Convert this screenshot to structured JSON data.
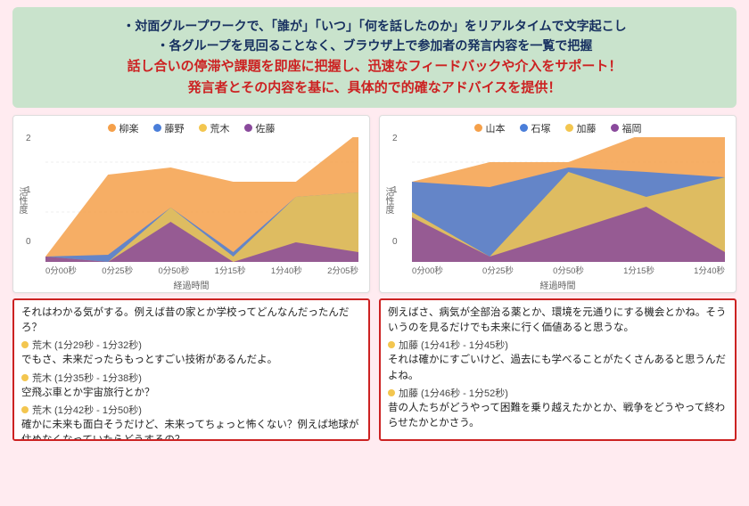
{
  "header": {
    "line1": "・対面グループワークで、「誰が」「いつ」「何を話したのか」をリアルタイムで文字起こし",
    "line2": "・各グループを見回ることなく、ブラウザ上で参加者の発言内容を一覧で把握",
    "line3": "話し合いの停滞や課題を即座に把握し、迅速なフィードバックや介入をサポート！",
    "line4": "発言者とその内容を基に、具体的で的確なアドバイスを提供！"
  },
  "chart_data": [
    {
      "type": "area",
      "title": "",
      "xlabel": "経過時間",
      "ylabel": "活性度",
      "ylim": [
        0,
        2.5
      ],
      "y_ticks": [
        0,
        1,
        2
      ],
      "categories": [
        "0分00秒",
        "0分25秒",
        "0分50秒",
        "1分15秒",
        "1分40秒",
        "2分05秒"
      ],
      "series": [
        {
          "name": "柳楽",
          "color": "#f5a04a",
          "values": [
            0.0,
            1.6,
            0.8,
            1.4,
            0.3,
            1.2
          ]
        },
        {
          "name": "藤野",
          "color": "#4a7ed9",
          "values": [
            0.0,
            0.1,
            0.0,
            0.1,
            0.0,
            0.1
          ]
        },
        {
          "name": "荒木",
          "color": "#f3c64f",
          "values": [
            0.0,
            0.0,
            0.3,
            0.1,
            0.9,
            1.2
          ]
        },
        {
          "name": "佐藤",
          "color": "#8a4a9c",
          "values": [
            0.1,
            0.0,
            0.8,
            0.0,
            0.4,
            0.2
          ]
        }
      ]
    },
    {
      "type": "area",
      "title": "",
      "xlabel": "経過時間",
      "ylabel": "活性度",
      "ylim": [
        0,
        2.5
      ],
      "y_ticks": [
        0,
        1,
        2
      ],
      "categories": [
        "0分00秒",
        "0分25秒",
        "0分50秒",
        "1分15秒",
        "1分40秒"
      ],
      "series": [
        {
          "name": "山本",
          "color": "#f5a04a",
          "values": [
            0.0,
            0.5,
            0.1,
            0.8,
            1.2
          ]
        },
        {
          "name": "石塚",
          "color": "#4a7ed9",
          "values": [
            0.6,
            1.4,
            0.1,
            0.5,
            0.0
          ]
        },
        {
          "name": "加藤",
          "color": "#f3c64f",
          "values": [
            0.1,
            0.0,
            1.2,
            0.2,
            1.5
          ]
        },
        {
          "name": "福岡",
          "color": "#8a4a9c",
          "values": [
            0.9,
            0.1,
            0.6,
            1.1,
            0.2
          ]
        }
      ]
    }
  ],
  "transcripts": {
    "left": [
      {
        "type": "text",
        "text": "それはわかる気がする。例えば昔の家とか学校ってどんなんだったんだろ？"
      },
      {
        "type": "speaker",
        "color": "#f3c64f",
        "text": "荒木 (1分29秒 - 1分32秒)"
      },
      {
        "type": "text",
        "text": "でもさ、未来だったらもっとすごい技術があるんだよ。"
      },
      {
        "type": "speaker",
        "color": "#f3c64f",
        "text": "荒木 (1分35秒 - 1分38秒)"
      },
      {
        "type": "text",
        "text": "空飛ぶ車とか宇宙旅行とか？"
      },
      {
        "type": "speaker",
        "color": "#f3c64f",
        "text": "荒木 (1分42秒 - 1分50秒)"
      },
      {
        "type": "text",
        "text": "確かに未来も面白そうだけど、未来ってちょっと怖くない？例えば地球が住めなくなっていたらどうするの？"
      }
    ],
    "right": [
      {
        "type": "text",
        "text": "例えばさ、病気が全部治る薬とか、環境を元通りにする機会とかね。そういうのを見るだけでも未来に行く価値あると思うな。"
      },
      {
        "type": "speaker",
        "color": "#f3c64f",
        "text": "加藤 (1分41秒 - 1分45秒)"
      },
      {
        "type": "text",
        "text": "それは確かにすごいけど、過去にも学べることがたくさんあると思うんだよね。"
      },
      {
        "type": "speaker",
        "color": "#f3c64f",
        "text": "加藤 (1分46秒 - 1分52秒)"
      },
      {
        "type": "text",
        "text": "昔の人たちがどうやって困難を乗り越えたかとか、戦争をどうやって終わらせたかとかさう。"
      }
    ]
  }
}
